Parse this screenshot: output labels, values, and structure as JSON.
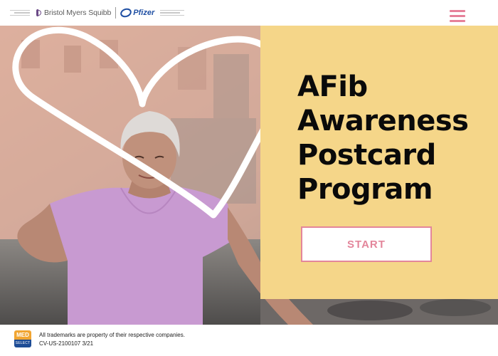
{
  "header": {
    "brand_bms": "Bristol Myers Squibb",
    "brand_pfizer": "Pfizer",
    "menu_icon": "hamburger-menu-icon"
  },
  "hero": {
    "headline_lines": [
      "AFib",
      "Awareness",
      "Postcard",
      "Program"
    ],
    "start_label": "START"
  },
  "footer": {
    "badge_top": "MED",
    "badge_bottom": "SELECT",
    "trademark": "All trademarks are property of their respective companies.",
    "code": "CV-US-2100107 3/21"
  },
  "colors": {
    "accent_pink": "#e3869b",
    "panel_yellow": "#f5d689",
    "heart_outline": "#ffffff",
    "headline": "#0a0a0a",
    "pfizer_blue": "#1f4fa3",
    "bms_purple": "#6b4a87"
  }
}
